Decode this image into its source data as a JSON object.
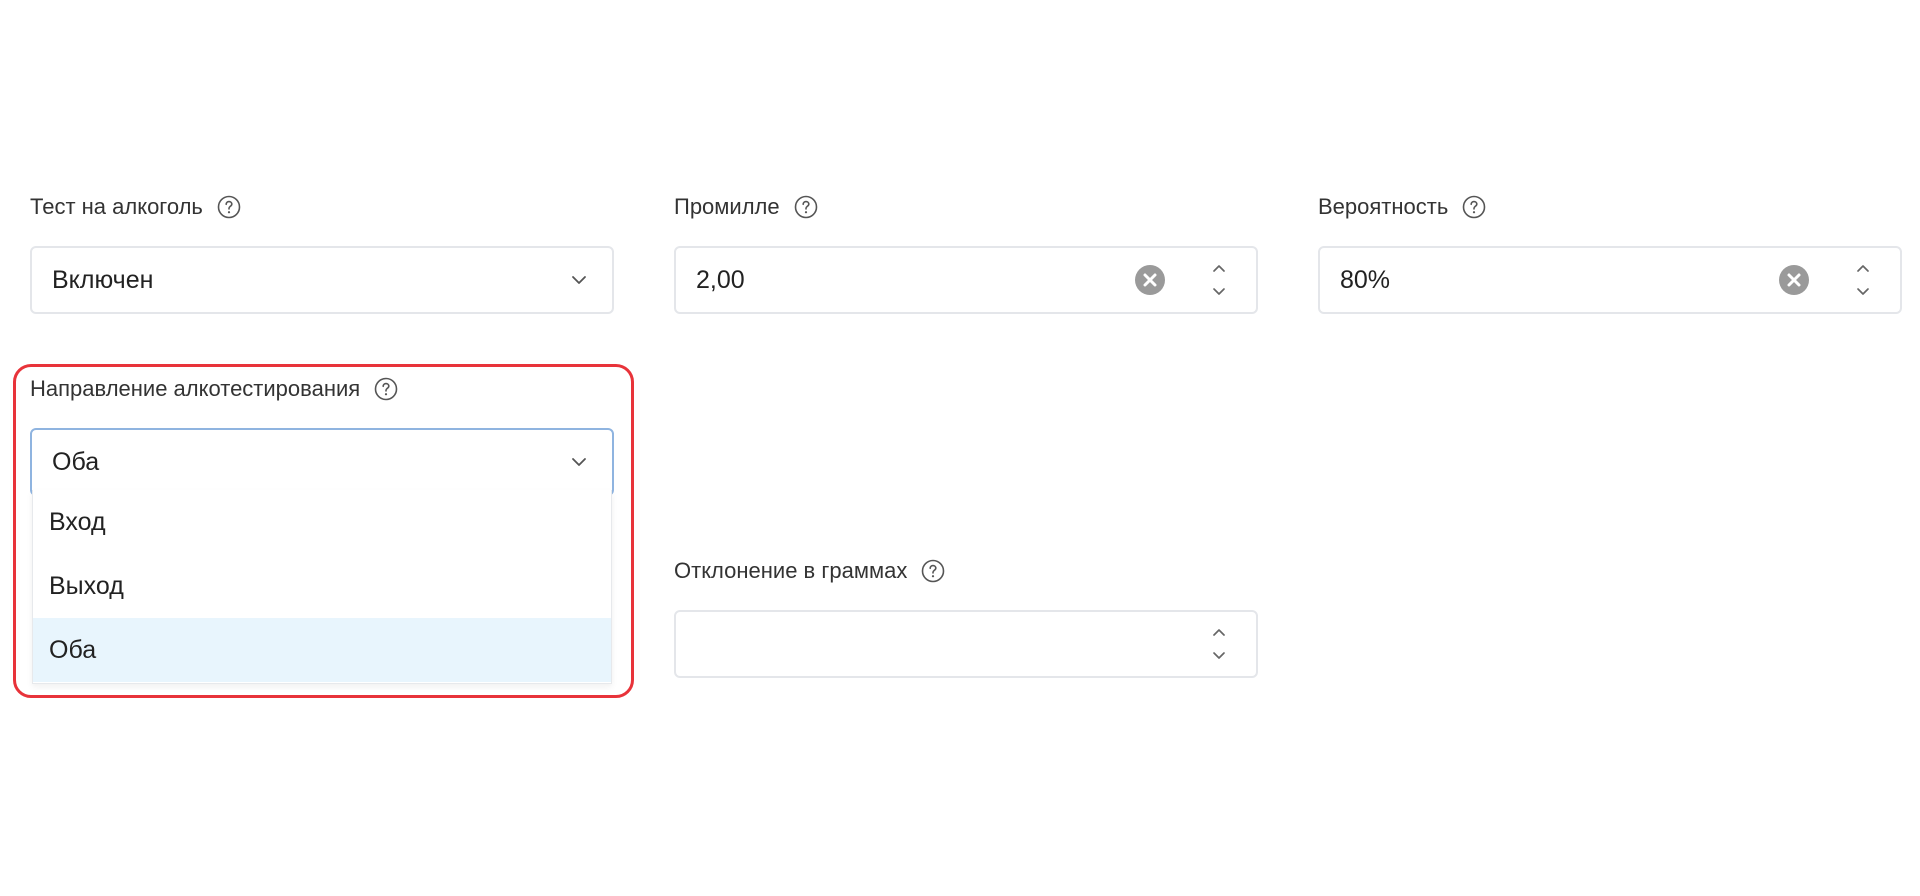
{
  "fields": {
    "alcohol_test": {
      "label": "Тест на алкоголь",
      "value": "Включен",
      "help_icon": "question-circle-icon"
    },
    "promille": {
      "label": "Промилле",
      "value": "2,00",
      "help_icon": "question-circle-icon"
    },
    "probability": {
      "label": "Вероятность",
      "value": "80%",
      "help_icon": "question-circle-icon"
    },
    "direction": {
      "label": "Направление алкотестирования",
      "value": "Оба",
      "help_icon": "question-circle-icon",
      "options": [
        "Вход",
        "Выход",
        "Оба"
      ],
      "selected_option": "Оба"
    },
    "deviation": {
      "label": "Отклонение в граммах",
      "value": "",
      "help_icon": "question-circle-icon"
    }
  },
  "colors": {
    "highlight_frame": "#e8333a",
    "selected_option_bg": "#e8f5fd",
    "focused_border": "#8fb4e0",
    "input_border": "#e4e6ea",
    "clear_icon": "#9a9a9a"
  }
}
